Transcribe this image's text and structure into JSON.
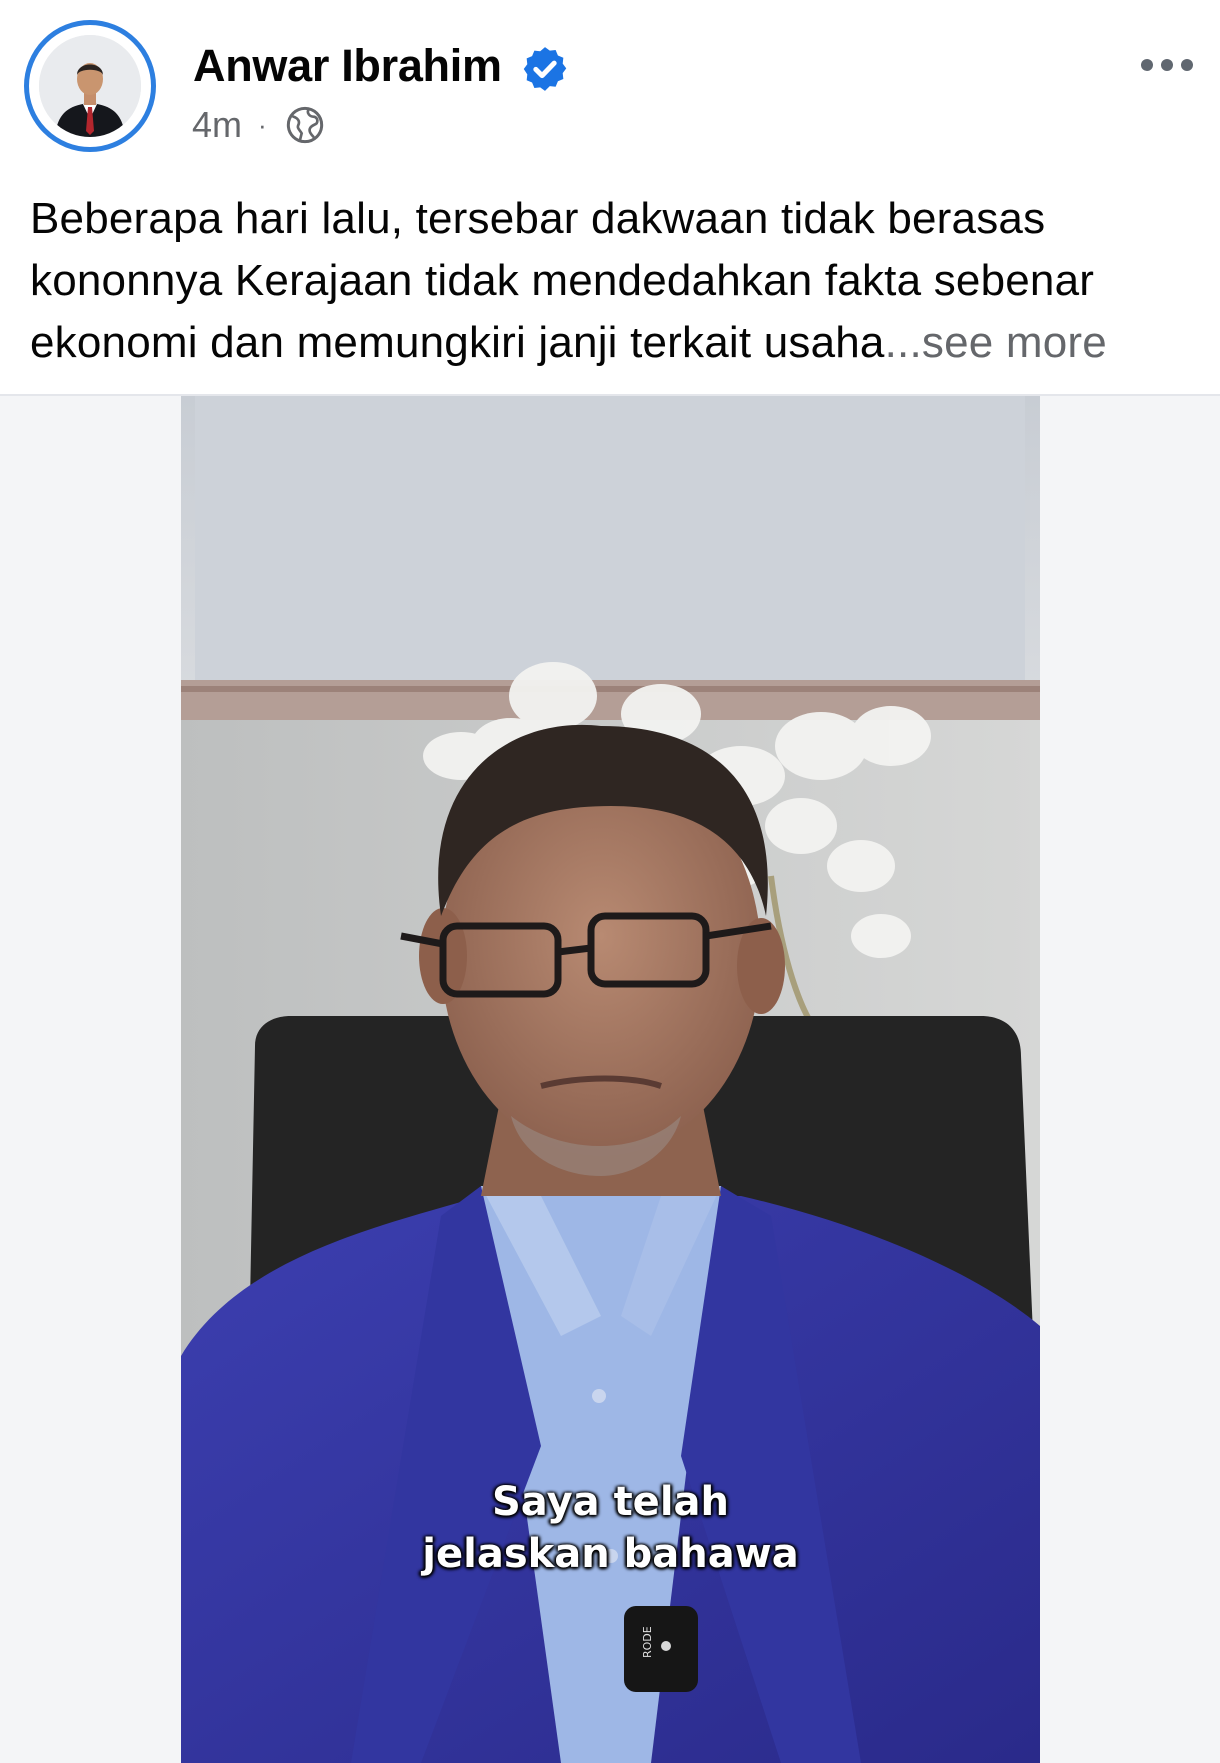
{
  "post": {
    "author": "Anwar Ibrahim",
    "time": "4m",
    "separator": "·",
    "text": "Beberapa hari lalu, tersebar dakwaan tidak berasas kononnya Kerajaan tidak mendedahkan fakta sebenar ekonomi dan memungkiri janji terkait usaha",
    "see_more": "...see more"
  },
  "video": {
    "caption_line1": "Saya telah",
    "caption_line2": "jelaskan bahawa",
    "mic_brand": "RODE"
  },
  "icons": {
    "verified": "verified-badge-icon",
    "audience": "globe-icon",
    "more": "more-options-icon"
  },
  "colors": {
    "verified_blue": "#1b74e4",
    "avatar_ring": "#2d7fe0",
    "secondary_text": "#65676b"
  }
}
